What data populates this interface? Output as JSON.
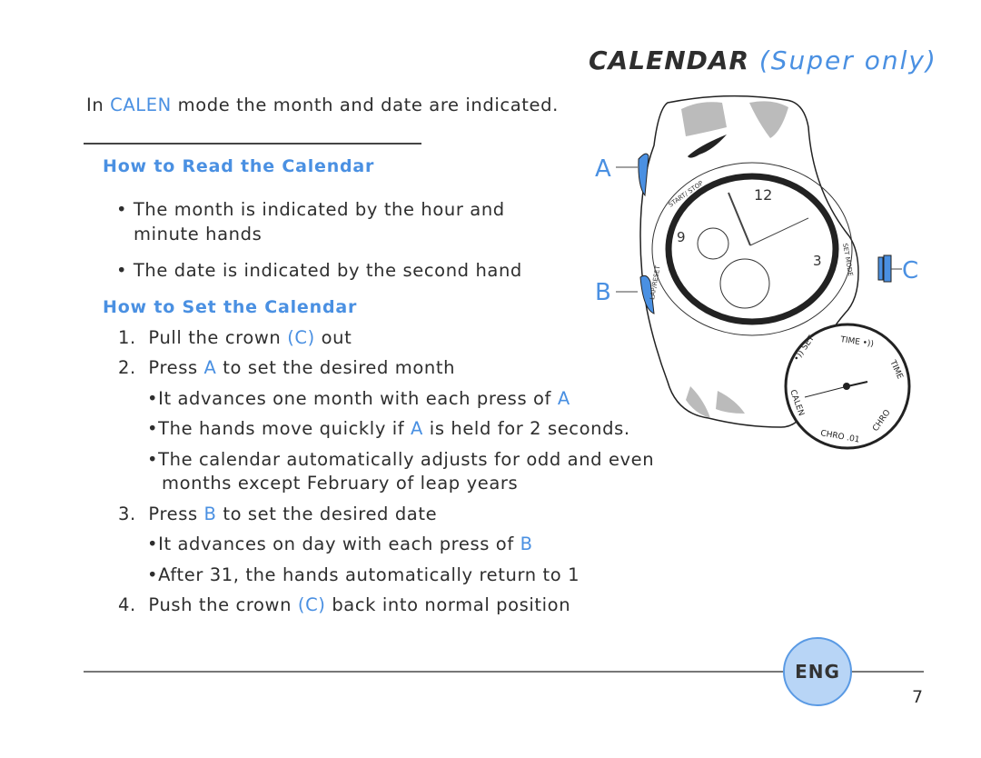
{
  "title": {
    "main": "CALENDAR",
    "sub": "(Super only)"
  },
  "intro": {
    "prefix": "In ",
    "mode": "CALEN",
    "suffix": " mode the month and date are indicated."
  },
  "read": {
    "heading": "How to Read the Calendar",
    "bullets": [
      {
        "line1": "The month is indicated by the hour and",
        "line2": "minute hands"
      },
      {
        "line1": "The date is indicated by the second hand"
      }
    ]
  },
  "set": {
    "heading": "How to Set the Calendar",
    "steps": [
      {
        "num": "1.",
        "pre": "Pull the crown ",
        "key": "(C)",
        "post": " out"
      },
      {
        "num": "2.",
        "pre": "Press ",
        "key": "A",
        "post": " to set the desired month"
      },
      {
        "num": "3.",
        "pre": "Press ",
        "key": "B",
        "post": " to set the desired date"
      },
      {
        "num": "4.",
        "pre": "Push the crown ",
        "key": "(C)",
        "post": " back into normal position"
      }
    ],
    "step2_subs": [
      {
        "pre": "It advances one month with each press of ",
        "key": "A",
        "post": ""
      },
      {
        "pre": "The hands move quickly if ",
        "key": "A",
        "post": " is held for 2 seconds."
      },
      {
        "pre": "The calendar automatically adjusts for odd and even",
        "key": "",
        "post": "",
        "line2": "months except February of leap years"
      }
    ],
    "step3_subs": [
      {
        "pre": "It advances on day with each press of ",
        "key": "B",
        "post": ""
      },
      {
        "pre": "After 31, the hands automatically return to 1",
        "key": "",
        "post": ""
      }
    ]
  },
  "watch": {
    "labels": {
      "a": "A",
      "b": "B",
      "c": "C"
    },
    "bezel": {
      "start_stop": "START/ STOP",
      "lap_reset": "LAP/RESET",
      "set_mode": "SET MODE"
    },
    "numerals": {
      "twelve": "12",
      "nine": "9",
      "three": "3"
    },
    "dial": {
      "time_top": "TIME •))",
      "set": "•)) SET",
      "time_right": "TIME",
      "calen": "CALEN",
      "chro01": "CHRO .01",
      "chro": "CHRO"
    }
  },
  "footer": {
    "lang": "ENG",
    "page": "7"
  },
  "colors": {
    "accent": "#4a90e2",
    "text": "#2e2e2e",
    "badge_fill": "#b8d5f6"
  }
}
